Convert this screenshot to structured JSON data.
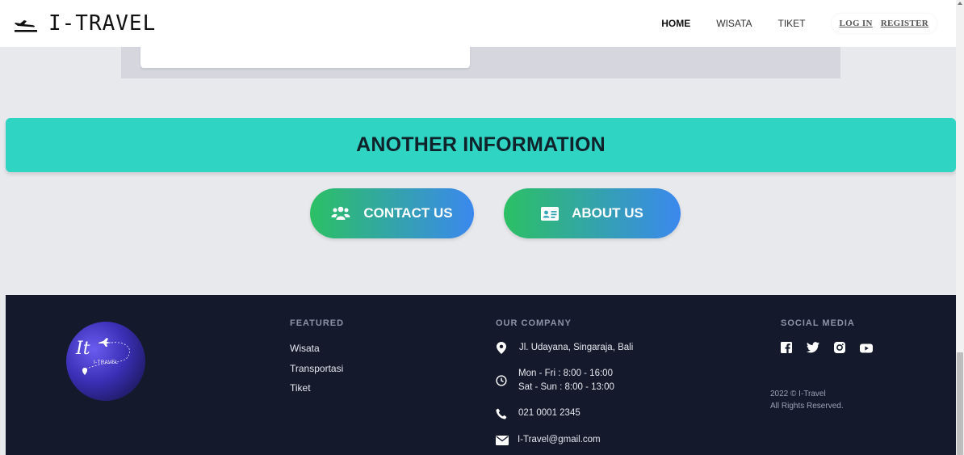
{
  "header": {
    "brand": "I-TRAVEL",
    "nav": [
      {
        "label": "HOME",
        "active": true
      },
      {
        "label": "WISATA",
        "active": false
      },
      {
        "label": "TIKET",
        "active": false
      }
    ],
    "login": "LOG IN",
    "register": "REGISTER"
  },
  "info": {
    "title": "ANOTHER INFORMATION",
    "contact_label": "CONTACT US",
    "about_label": "ABOUT US"
  },
  "footer": {
    "logo_text": "I-TRAVEL",
    "featured_title": "FEATURED",
    "featured_links": [
      "Wisata",
      "Transportasi",
      "Tiket"
    ],
    "company_title": "OUR COMPANY",
    "address": "Jl. Udayana, Singaraja, Bali",
    "hours_weekday": "Mon - Fri : 8:00 - 16:00",
    "hours_weekend": "Sat - Sun : 8:00 - 13:00",
    "phone": "021 0001 2345",
    "email": "I-Travel@gmail.com",
    "social_title": "SOCIAL MEDIA",
    "social_icons": [
      "facebook-icon",
      "twitter-icon",
      "instagram-icon",
      "youtube-icon"
    ],
    "copyright_year": "2022 © I-Travel",
    "copyright_rights": "All Rights Reserved."
  },
  "colors": {
    "band": "#2fd4c3",
    "footer_bg": "#141a2b",
    "gradient_start": "#2cc064",
    "gradient_end": "#3b88ee"
  }
}
